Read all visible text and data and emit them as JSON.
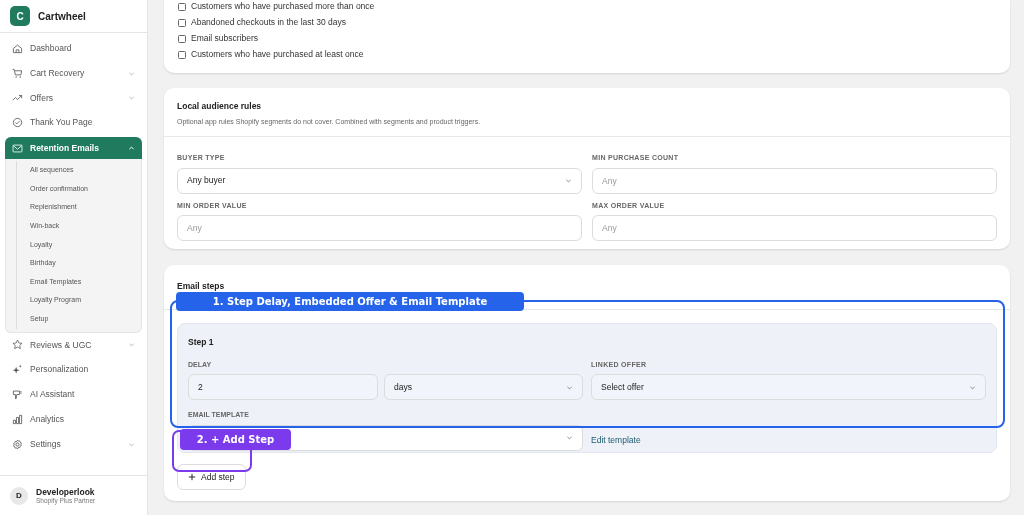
{
  "brand": {
    "initial": "C",
    "name": "Cartwheel"
  },
  "sidebar": {
    "items": [
      {
        "label": "Dashboard",
        "selected": false
      },
      {
        "label": "Cart Recovery",
        "selected": false,
        "expanded": false
      },
      {
        "label": "Offers",
        "selected": false,
        "expanded": false
      },
      {
        "label": "Thank You Page",
        "selected": false
      },
      {
        "label": "Retention Emails",
        "selected": true,
        "expanded": true,
        "children": [
          {
            "label": "All sequences",
            "selected": false
          },
          {
            "label": "Order confirmation",
            "selected": false
          },
          {
            "label": "Replenishment",
            "selected": false
          },
          {
            "label": "Win-back",
            "selected": false
          },
          {
            "label": "Loyalty",
            "selected": false
          },
          {
            "label": "Birthday",
            "selected": false
          },
          {
            "label": "Email Templates",
            "selected": false
          },
          {
            "label": "Loyalty Program",
            "selected": false
          },
          {
            "label": "Setup",
            "selected": false
          }
        ]
      },
      {
        "label": "Reviews & UGC",
        "selected": false,
        "expanded": false
      },
      {
        "label": "Personalization",
        "selected": false
      },
      {
        "label": "AI Assistant",
        "selected": false
      },
      {
        "label": "Analytics",
        "selected": false
      },
      {
        "label": "Settings",
        "selected": false,
        "expanded": false
      }
    ],
    "user": {
      "initial": "D",
      "name": "Developerlook",
      "role": "Shopify Plus Partner"
    }
  },
  "segments": [
    {
      "label": "Customers who have purchased more than once",
      "checked": false
    },
    {
      "label": "Abandoned checkouts in the last 30 days",
      "checked": false
    },
    {
      "label": "Email subscribers",
      "checked": false
    },
    {
      "label": "Customers who have purchased at least once",
      "checked": false
    }
  ],
  "local_rules": {
    "title": "Local audience rules",
    "description": "Optional app rules Shopify segments do not cover. Combined with segments and product triggers.",
    "fields": [
      {
        "label": "BUYER TYPE",
        "kind": "select",
        "value": "Any buyer"
      },
      {
        "label": "MIN PURCHASE COUNT",
        "kind": "input",
        "placeholder": "Any"
      },
      {
        "label": "MIN ORDER VALUE",
        "kind": "input",
        "placeholder": "Any"
      },
      {
        "label": "MAX ORDER VALUE",
        "kind": "input",
        "placeholder": "Any"
      }
    ]
  },
  "email_steps": {
    "title": "Email steps",
    "steps": [
      {
        "title": "Step 1",
        "delay_label": "DELAY",
        "delay_value": "2",
        "delay_unit": "days",
        "offer_label": "LINKED OFFER",
        "offer_value": "Select offer",
        "template_label": "EMAIL TEMPLATE",
        "edit_link": "Edit template"
      }
    ],
    "add_button": "Add step"
  },
  "annotations": [
    {
      "label": "1. Step Delay, Embedded Offer & Email Template",
      "color": "#2563eb"
    },
    {
      "label": "2. + Add Step",
      "color": "#7c3aed"
    }
  ]
}
